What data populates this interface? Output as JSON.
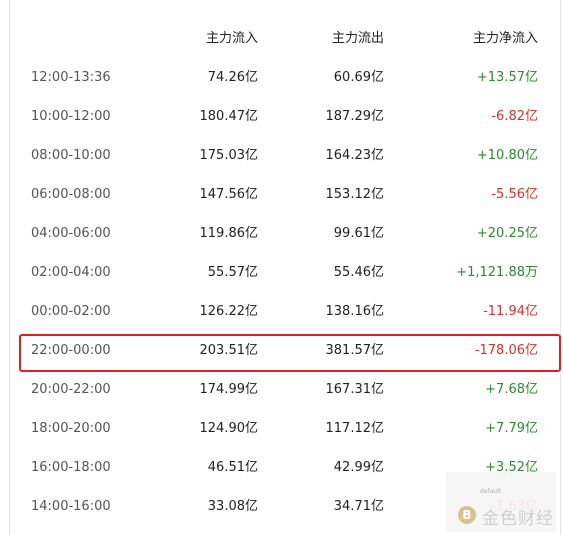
{
  "table": {
    "headers": {
      "time": "",
      "inflow": "主力流入",
      "outflow": "主力流出",
      "net": "主力净流入"
    },
    "rows": [
      {
        "time": "12:00-13:36",
        "inflow": "74.26亿",
        "outflow": "60.69亿",
        "net": "+13.57亿",
        "dir": "pos"
      },
      {
        "time": "10:00-12:00",
        "inflow": "180.47亿",
        "outflow": "187.29亿",
        "net": "-6.82亿",
        "dir": "neg"
      },
      {
        "time": "08:00-10:00",
        "inflow": "175.03亿",
        "outflow": "164.23亿",
        "net": "+10.80亿",
        "dir": "pos"
      },
      {
        "time": "06:00-08:00",
        "inflow": "147.56亿",
        "outflow": "153.12亿",
        "net": "-5.56亿",
        "dir": "neg"
      },
      {
        "time": "04:00-06:00",
        "inflow": "119.86亿",
        "outflow": "99.61亿",
        "net": "+20.25亿",
        "dir": "pos"
      },
      {
        "time": "02:00-04:00",
        "inflow": "55.57亿",
        "outflow": "55.46亿",
        "net": "+1,121.88万",
        "dir": "pos"
      },
      {
        "time": "00:00-02:00",
        "inflow": "126.22亿",
        "outflow": "138.16亿",
        "net": "-11.94亿",
        "dir": "neg"
      },
      {
        "time": "22:00-00:00",
        "inflow": "203.51亿",
        "outflow": "381.57亿",
        "net": "-178.06亿",
        "dir": "neg",
        "highlighted": true
      },
      {
        "time": "20:00-22:00",
        "inflow": "174.99亿",
        "outflow": "167.31亿",
        "net": "+7.68亿",
        "dir": "pos"
      },
      {
        "time": "18:00-20:00",
        "inflow": "124.90亿",
        "outflow": "117.12亿",
        "net": "+7.79亿",
        "dir": "pos"
      },
      {
        "time": "16:00-18:00",
        "inflow": "46.51亿",
        "outflow": "42.99亿",
        "net": "+3.52亿",
        "dir": "pos"
      },
      {
        "time": "14:00-16:00",
        "inflow": "33.08亿",
        "outflow": "34.71亿",
        "net": "-1.63亿",
        "dir": "neg"
      }
    ]
  },
  "colors": {
    "positive": "#2d8a2d",
    "negative": "#d9302b",
    "highlight_border": "#e02020"
  },
  "watermark": {
    "small_text": "default",
    "brand_text": "金色财经",
    "logo_glyph": "B"
  }
}
